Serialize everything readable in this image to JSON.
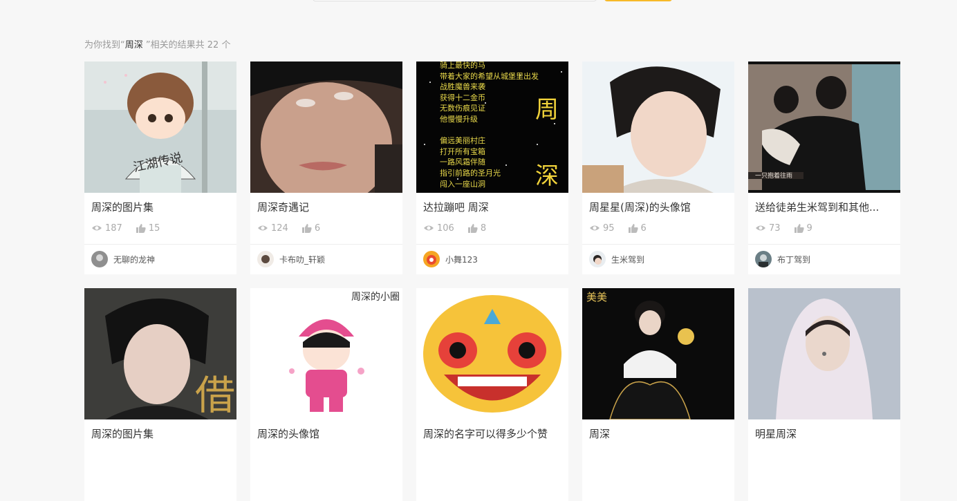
{
  "search": {
    "summary_prefix": "为你找到“",
    "keyword": "周深",
    "summary_middle": " ”相关的结果共 ",
    "count": "22",
    "summary_suffix": " 个"
  },
  "colors": {
    "accent": "#f7b928",
    "background": "#f7f7f7",
    "card": "#ffffff",
    "muted": "#aaaaaa"
  },
  "icons": {
    "views": "eye-icon",
    "likes": "thumbs-up-icon"
  },
  "cards": [
    {
      "title": "周深的图片集",
      "views": "187",
      "likes": "15",
      "author": "无聊的龙神",
      "thumb_alt": "anime chibi boy with fan reading 江湖传说",
      "thumb_text": "江湖传说"
    },
    {
      "title": "周深奇遇记",
      "views": "124",
      "likes": "6",
      "author": "卡布叻_轩颖",
      "thumb_alt": "close-up face photo"
    },
    {
      "title": "达拉蹦吧 周深",
      "views": "106",
      "likes": "8",
      "author": "小舞123",
      "thumb_alt": "starry black poster with yellow text",
      "thumb_lines": [
        "骑上最快的马",
        "带着大家的希望从城堡里出发",
        "战胜魔兽来袭",
        "获得十二金币",
        "无数伤痕见证",
        "他慢慢升级",
        "",
        "偏远美丽村庄",
        "打开所有宝箱",
        "一路风霜伴随",
        "指引前路的圣月光",
        "闯入一座山洞"
      ],
      "thumb_big": [
        "周",
        "深"
      ]
    },
    {
      "title": "周星星(周深)的头像馆",
      "views": "95",
      "likes": "6",
      "author": "生米驾到",
      "thumb_alt": "profile portrait"
    },
    {
      "title": "送给徒弟生米驾到和其他...",
      "views": "73",
      "likes": "9",
      "author": "布丁驾到",
      "thumb_alt": "two people hugging on stage",
      "thumb_caption": "一只抱着往雨"
    },
    {
      "title": "周深的图片集",
      "views": "",
      "likes": "",
      "author": "",
      "thumb_alt": "portrait with 借 character",
      "thumb_text": "借"
    },
    {
      "title": "周深的头像馆",
      "views": "",
      "likes": "",
      "author": "",
      "thumb_alt": "chibi character in pink outfit",
      "thumb_text": "周深的小圈"
    },
    {
      "title": "周深的名字可以得多少个赞",
      "views": "",
      "likes": "",
      "author": "",
      "thumb_alt": "cartoon lion dance head"
    },
    {
      "title": "周深",
      "views": "",
      "likes": "",
      "author": "",
      "thumb_alt": "black and gold lotus poster",
      "thumb_text": "美美"
    },
    {
      "title": "明星周深",
      "views": "",
      "likes": "",
      "author": "",
      "thumb_alt": "person in white hooded jacket"
    }
  ]
}
